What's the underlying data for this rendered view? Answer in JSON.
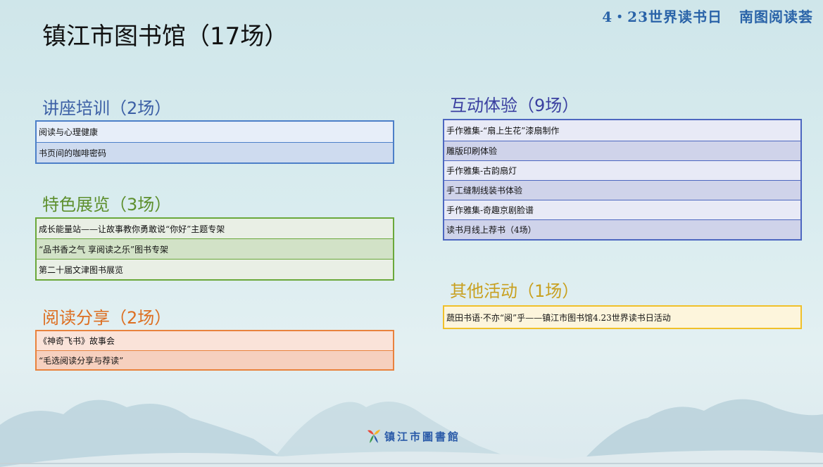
{
  "header": {
    "brand_left": "4・23世界读书日",
    "brand_right": "南图阅读荟"
  },
  "page_title": "镇江市图书馆（17场）",
  "sections": {
    "lectures": {
      "title": "讲座培训（2场）",
      "items": [
        "阅读与心理健康",
        "书页间的咖啡密码"
      ]
    },
    "exhibitions": {
      "title": "特色展览（3场）",
      "items": [
        "成长能量站——让故事教你勇敢说“你好”主题专架",
        "“品书香之气 享阅读之乐”图书专架",
        "第二十届文津图书展览"
      ]
    },
    "reading_share": {
      "title": "阅读分享（2场）",
      "items": [
        "《神奇飞书》故事会",
        "“毛选阅读分享与荐读”"
      ]
    },
    "interactive": {
      "title": "互动体验（9场）",
      "items": [
        "手作雅集-“扇上生花”漆扇制作",
        "雕版印刷体验",
        "手作雅集-古韵扇灯",
        "手工缝制线装书体验",
        "手作雅集-奇趣京剧脸谱",
        "读书月线上荐书（4场）"
      ]
    },
    "other": {
      "title": "其他活动（1场）",
      "items": [
        "蔬田书语·不亦“阅”乎——镇江市图书馆4.23世界读书日活动"
      ]
    }
  },
  "footer": {
    "logo_text": "镇江市圖書館",
    "logo_icon": "library-logo-icon"
  },
  "colors": {
    "brand_blue": "#2a63a8",
    "lectures": "#4c7fc8",
    "exhibitions": "#6aa83a",
    "reading_share": "#e9823d",
    "interactive": "#4d67c0",
    "other": "#f0c02a"
  }
}
